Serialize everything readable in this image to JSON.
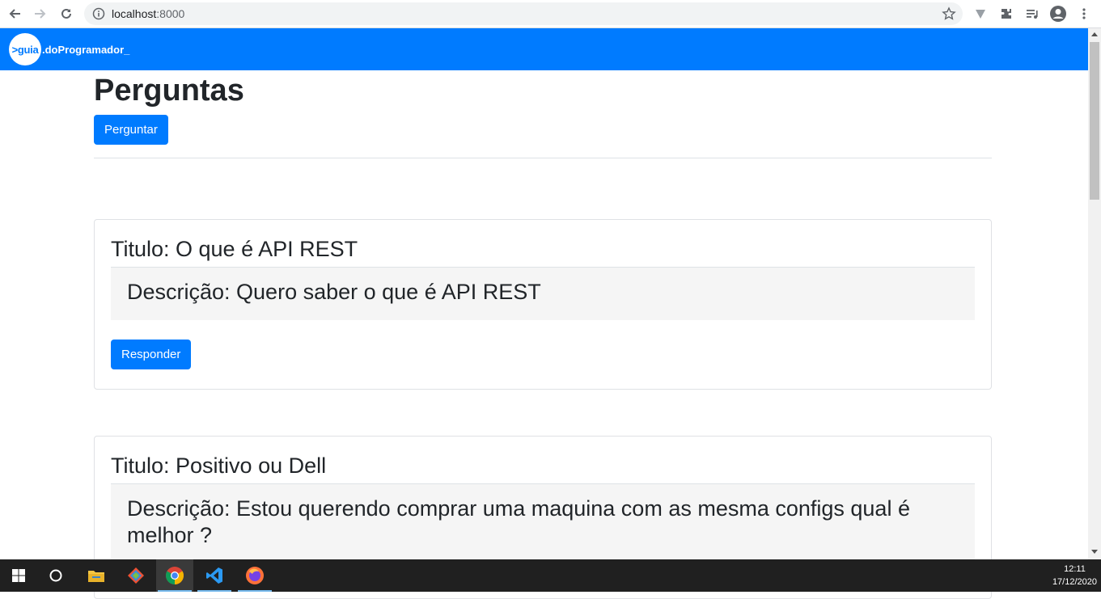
{
  "browser": {
    "url_host": "localhost",
    "url_port": ":8000"
  },
  "navbar": {
    "logo_circle": ">guia",
    "logo_text": ".doProgramador_",
    "color": "#007bff"
  },
  "page": {
    "title": "Perguntas",
    "ask_button": "Perguntar"
  },
  "questions": [
    {
      "title": "Titulo: O que é API REST",
      "description": "Descrição: Quero saber o que é API REST",
      "answer_button": "Responder"
    },
    {
      "title": "Titulo: Positivo ou Dell",
      "description": "Descrição: Estou querendo comprar uma maquina com as mesma configs qual é melhor ?"
    }
  ],
  "taskbar": {
    "time": "12:11",
    "date": "17/12/2020"
  },
  "icons": [
    "back-icon",
    "forward-icon",
    "reload-icon",
    "info-icon",
    "star-icon",
    "vpn-icon",
    "extensions-icon",
    "media-icon",
    "profile-icon",
    "menu-icon",
    "windows-start-icon",
    "search-icon",
    "file-explorer-icon",
    "git-icon",
    "chrome-icon",
    "vscode-icon",
    "firefox-icon"
  ]
}
